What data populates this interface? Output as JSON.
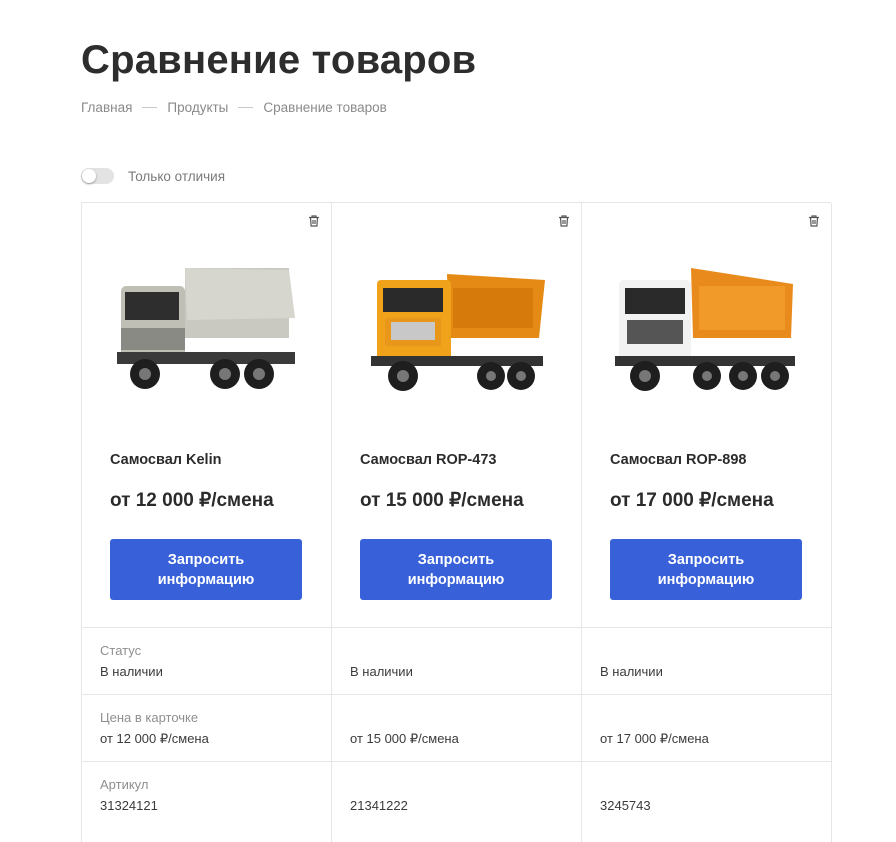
{
  "page": {
    "title": "Сравнение товаров"
  },
  "breadcrumbs": [
    "Главная",
    "Продукты",
    "Сравнение товаров"
  ],
  "filter": {
    "label": "Только отличия",
    "enabled": false
  },
  "products": [
    {
      "name": "Самосвал Kelin",
      "price": "от 12 000 ₽/смена",
      "button": "Запросить информацию",
      "image": "gray-dump-truck"
    },
    {
      "name": "Самосвал ROP-473",
      "price": "от 15 000 ₽/смена",
      "button": "Запросить информацию",
      "image": "yellow-dump-truck"
    },
    {
      "name": "Самосвал ROP-898",
      "price": "от 17 000 ₽/смена",
      "button": "Запросить информацию",
      "image": "white-orange-dump-truck"
    }
  ],
  "properties": [
    {
      "label": "Статус",
      "values": [
        "В наличии",
        "В наличии",
        "В наличии"
      ]
    },
    {
      "label": "Цена в карточке",
      "values": [
        "от 12 000 ₽/смена",
        "от 15 000 ₽/смена",
        "от 17 000 ₽/смена"
      ]
    },
    {
      "label": "Артикул",
      "values": [
        "31324121",
        "21341222",
        "3245743"
      ]
    }
  ],
  "colors": {
    "accent": "#3760d9"
  }
}
